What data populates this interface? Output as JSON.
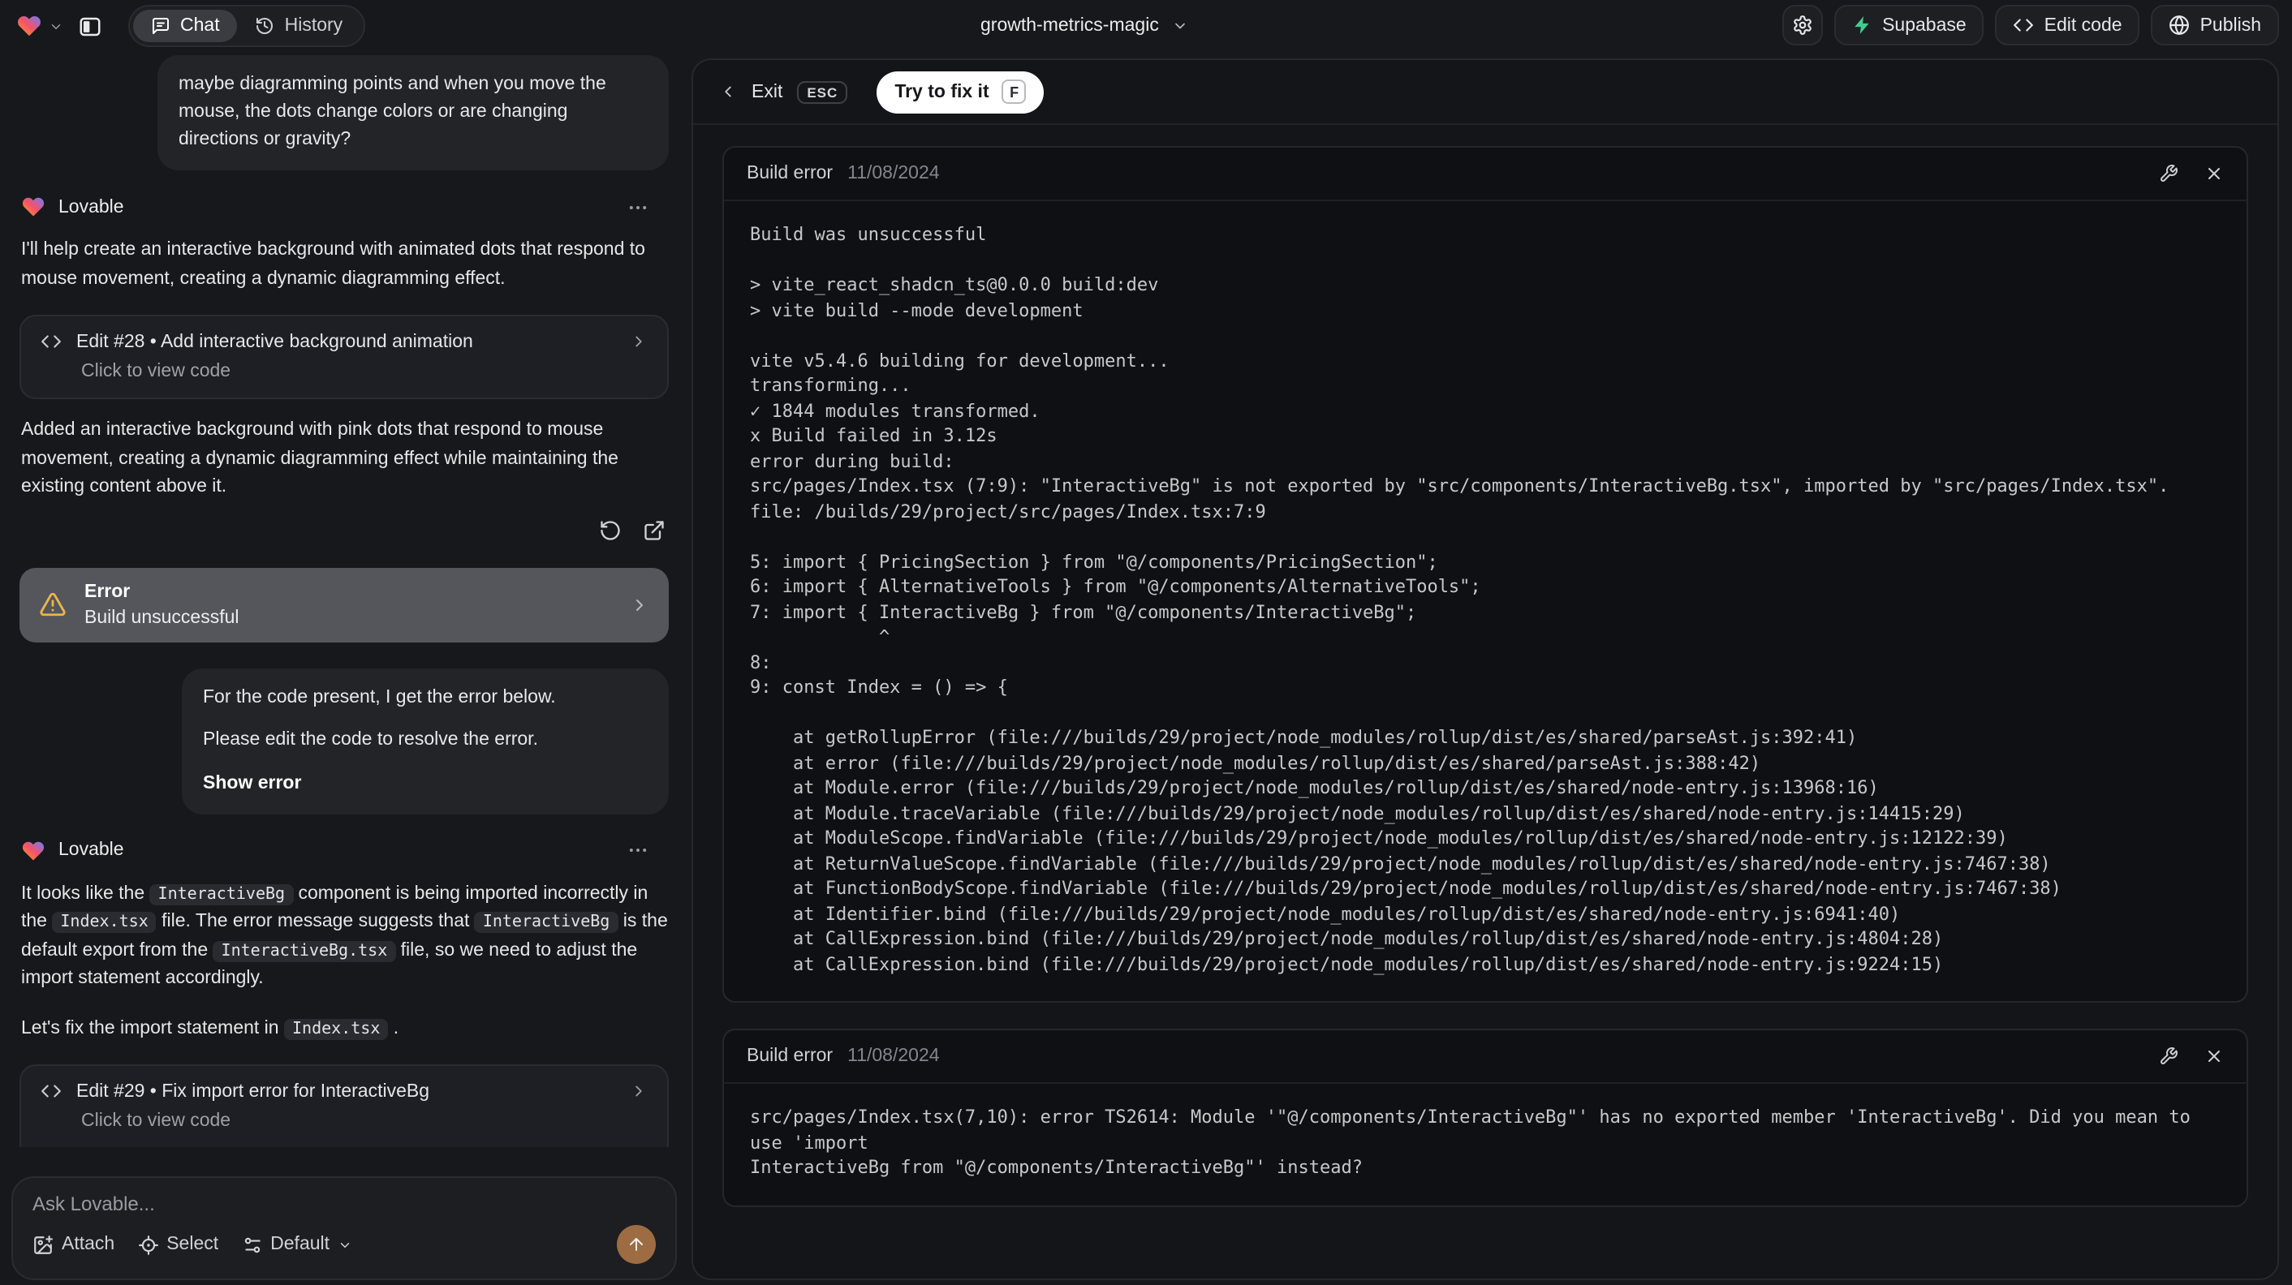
{
  "topbar": {
    "project_name": "growth-metrics-magic",
    "tabs": [
      {
        "label": "Chat"
      },
      {
        "label": "History"
      }
    ],
    "buttons": {
      "supabase": "Supabase",
      "edit_code": "Edit code",
      "publish": "Publish"
    }
  },
  "chat": {
    "assistant_name": "Lovable",
    "user_message_1": "maybe diagramming points and when you move the mouse, the dots change colors or are changing directions or gravity?",
    "lovable_msg_1": "I'll help create an interactive background with animated dots that respond to mouse movement, creating a dynamic diagramming effect.",
    "edit_card_28": {
      "title": "Edit #28 • Add interactive background animation",
      "subtitle": "Click to view code"
    },
    "lovable_msg_1b": "Added an interactive background with pink dots that respond to mouse movement, creating a dynamic diagramming effect while maintaining the existing content above it.",
    "error_card": {
      "title": "Error",
      "subtitle": "Build unsuccessful"
    },
    "user_message_2": {
      "line1": "For the code present, I get the error below.",
      "line2": "Please edit the code to resolve the error.",
      "link": "Show error"
    },
    "lovable_msg_2": {
      "p1": [
        "It looks like the ",
        "InteractiveBg",
        " component is being imported incorrectly in the ",
        "Index.tsx",
        " file. The error message suggests that ",
        "InteractiveBg",
        " is the default export from the ",
        "InteractiveBg.tsx",
        " file, so we need to adjust the import statement accordingly."
      ],
      "p2": [
        "Let's fix the import statement in ",
        "Index.tsx",
        " ."
      ]
    },
    "edit_card_29": {
      "title": "Edit #29 • Fix import error for InteractiveBg",
      "subtitle": "Click to view code"
    },
    "input": {
      "placeholder": "Ask Lovable...",
      "attach": "Attach",
      "select": "Select",
      "mode": "Default"
    }
  },
  "preview": {
    "exit_label": "Exit",
    "esc_key": "ESC",
    "fix_button": "Try to fix it",
    "fix_key": "F",
    "error_panels": [
      {
        "title": "Build error",
        "date": "11/08/2024",
        "log": "Build was unsuccessful\n\n> vite_react_shadcn_ts@0.0.0 build:dev\n> vite build --mode development\n\nvite v5.4.6 building for development...\ntransforming...\n✓ 1844 modules transformed.\nx Build failed in 3.12s\nerror during build:\nsrc/pages/Index.tsx (7:9): \"InteractiveBg\" is not exported by \"src/components/InteractiveBg.tsx\", imported by \"src/pages/Index.tsx\".\nfile: /builds/29/project/src/pages/Index.tsx:7:9\n\n5: import { PricingSection } from \"@/components/PricingSection\";\n6: import { AlternativeTools } from \"@/components/AlternativeTools\";\n7: import { InteractiveBg } from \"@/components/InteractiveBg\";\n            ^\n8: \n9: const Index = () => {\n\n    at getRollupError (file:///builds/29/project/node_modules/rollup/dist/es/shared/parseAst.js:392:41)\n    at error (file:///builds/29/project/node_modules/rollup/dist/es/shared/parseAst.js:388:42)\n    at Module.error (file:///builds/29/project/node_modules/rollup/dist/es/shared/node-entry.js:13968:16)\n    at Module.traceVariable (file:///builds/29/project/node_modules/rollup/dist/es/shared/node-entry.js:14415:29)\n    at ModuleScope.findVariable (file:///builds/29/project/node_modules/rollup/dist/es/shared/node-entry.js:12122:39)\n    at ReturnValueScope.findVariable (file:///builds/29/project/node_modules/rollup/dist/es/shared/node-entry.js:7467:38)\n    at FunctionBodyScope.findVariable (file:///builds/29/project/node_modules/rollup/dist/es/shared/node-entry.js:7467:38)\n    at Identifier.bind (file:///builds/29/project/node_modules/rollup/dist/es/shared/node-entry.js:6941:40)\n    at CallExpression.bind (file:///builds/29/project/node_modules/rollup/dist/es/shared/node-entry.js:4804:28)\n    at CallExpression.bind (file:///builds/29/project/node_modules/rollup/dist/es/shared/node-entry.js:9224:15)"
      },
      {
        "title": "Build error",
        "date": "11/08/2024",
        "log": "src/pages/Index.tsx(7,10): error TS2614: Module '\"@/components/InteractiveBg\"' has no exported member 'InteractiveBg'. Did you mean to use 'import\nInteractiveBg from \"@/components/InteractiveBg\"' instead?"
      }
    ]
  },
  "colors": {
    "page_bg": "#17181b",
    "panel_bg": "#141518",
    "log_bg": "#0f1013",
    "bubble_bg": "#232428",
    "card_bg": "#1e1f24",
    "error_card_bg": "#54565c",
    "warning_amber": "#e8b64c",
    "supabase_green": "#3ecf8e",
    "send_button_orange": "#9e6c43",
    "fix_pill_bg": "#ffffff"
  }
}
